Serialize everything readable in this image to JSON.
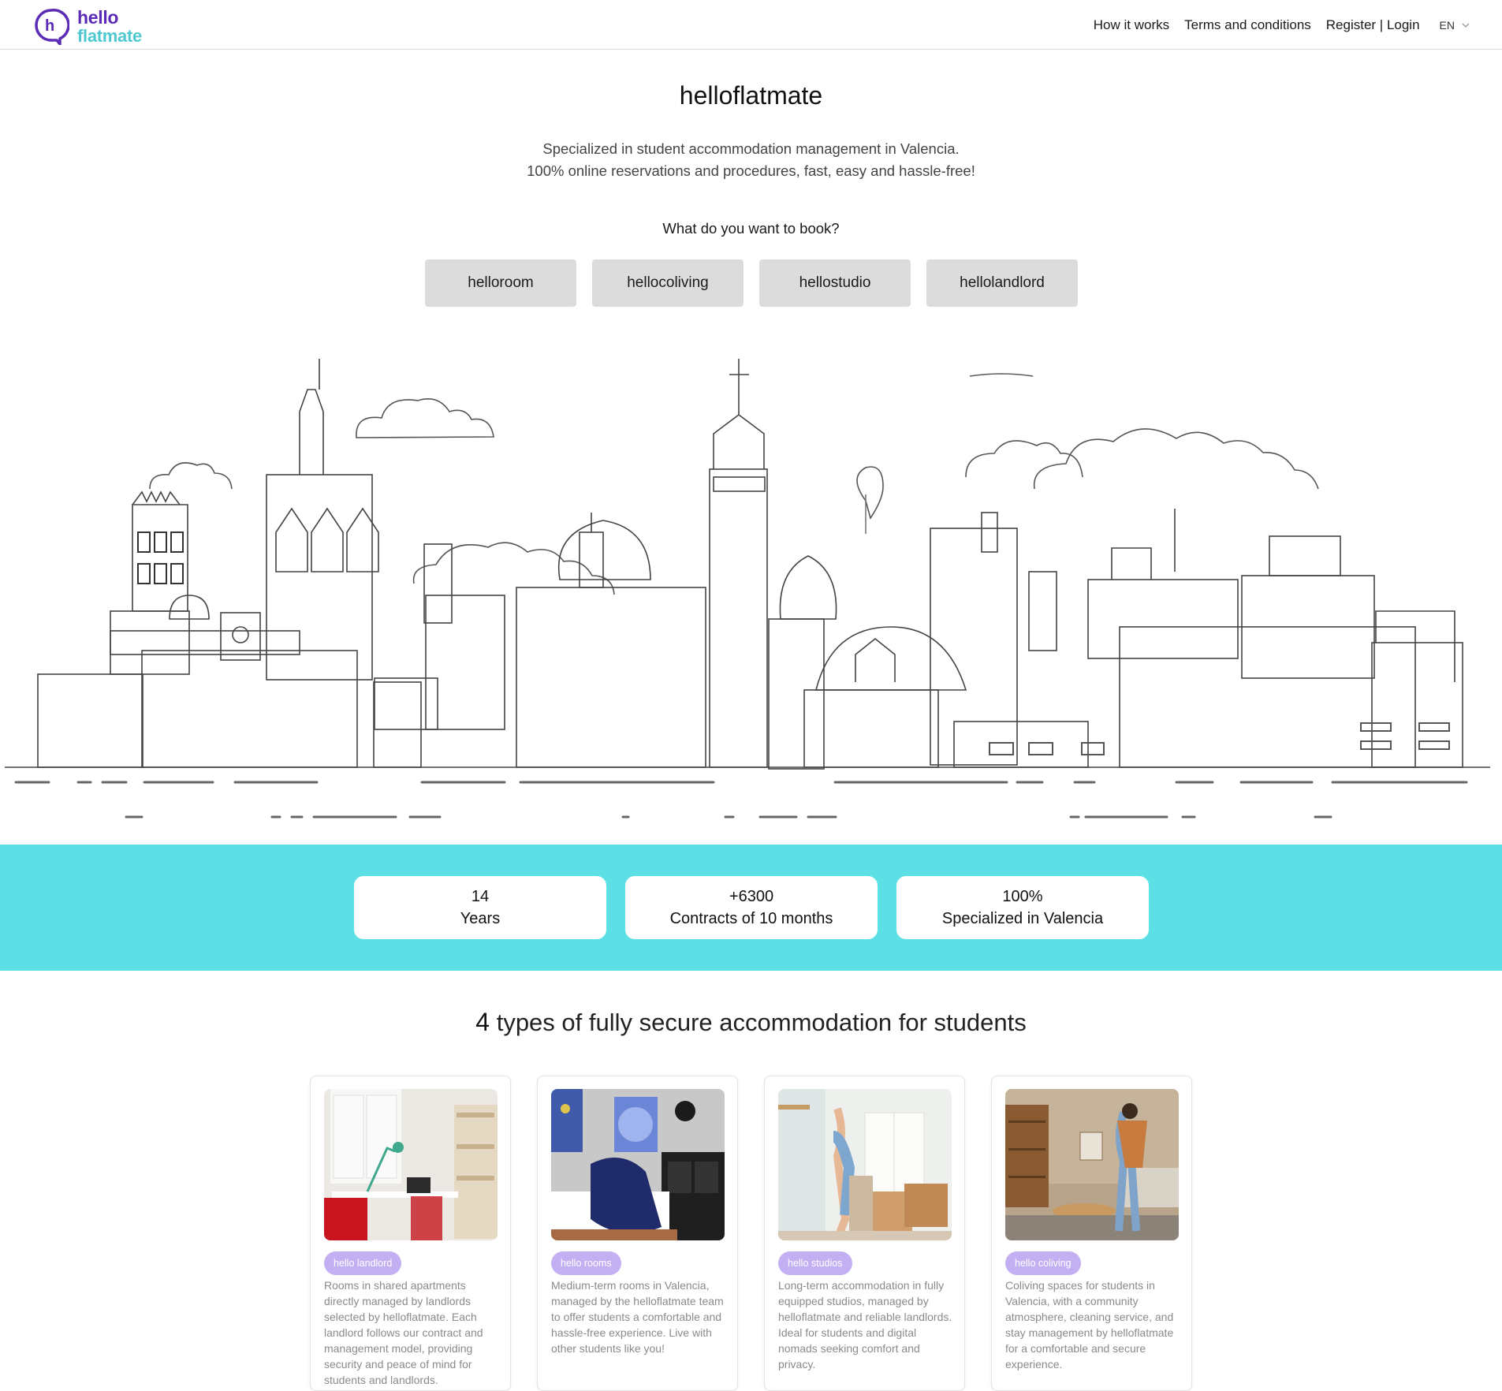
{
  "header": {
    "logo_top": "hello",
    "logo_bottom": "flatmate",
    "nav": [
      "How it works",
      "Terms and conditions",
      "Register | Login"
    ],
    "language": "EN"
  },
  "hero": {
    "title": "helloflatmate",
    "subtitle_line1": "Specialized in student accommodation management in Valencia.",
    "subtitle_line2": "100% online reservations and procedures, fast, easy and hassle-free!",
    "question": "What do you want to book?",
    "buttons": [
      "helloroom",
      "hellocoliving",
      "hellostudio",
      "hellolandlord"
    ]
  },
  "stats": [
    {
      "value": "14",
      "label": "Years"
    },
    {
      "value": "+6300",
      "label": "Contracts of 10 months"
    },
    {
      "value": "100%",
      "label": "Specialized in Valencia"
    }
  ],
  "types": {
    "title_number": "4",
    "title_rest": " types of fully secure accommodation for students",
    "cards": [
      {
        "tag": "hello landlord",
        "description": "Rooms in shared apartments directly managed by landlords selected by helloflatmate. Each landlord follows our contract and management model, providing security and peace of mind for students and landlords."
      },
      {
        "tag": "hello rooms",
        "description": "Medium-term rooms in Valencia, managed by the helloflatmate team to offer students a comfortable and hassle-free experience. Live with other students like you!"
      },
      {
        "tag": "hello studios",
        "description": "Long-term accommodation in fully equipped studios, managed by helloflatmate and reliable landlords. Ideal for students and digital nomads seeking comfort and privacy."
      },
      {
        "tag": "hello coliving",
        "description": "Coliving spaces for students in Valencia, with a community atmosphere, cleaning service, and stay management by helloflatmate for a comfortable and secure experience."
      }
    ]
  },
  "colors": {
    "brand_purple": "#5b2bb5",
    "brand_cyan": "#4ec9d1",
    "stats_band": "#5ce0e5",
    "tag_lavender": "#c3b0f2",
    "button_grey": "#dcdcdc"
  }
}
